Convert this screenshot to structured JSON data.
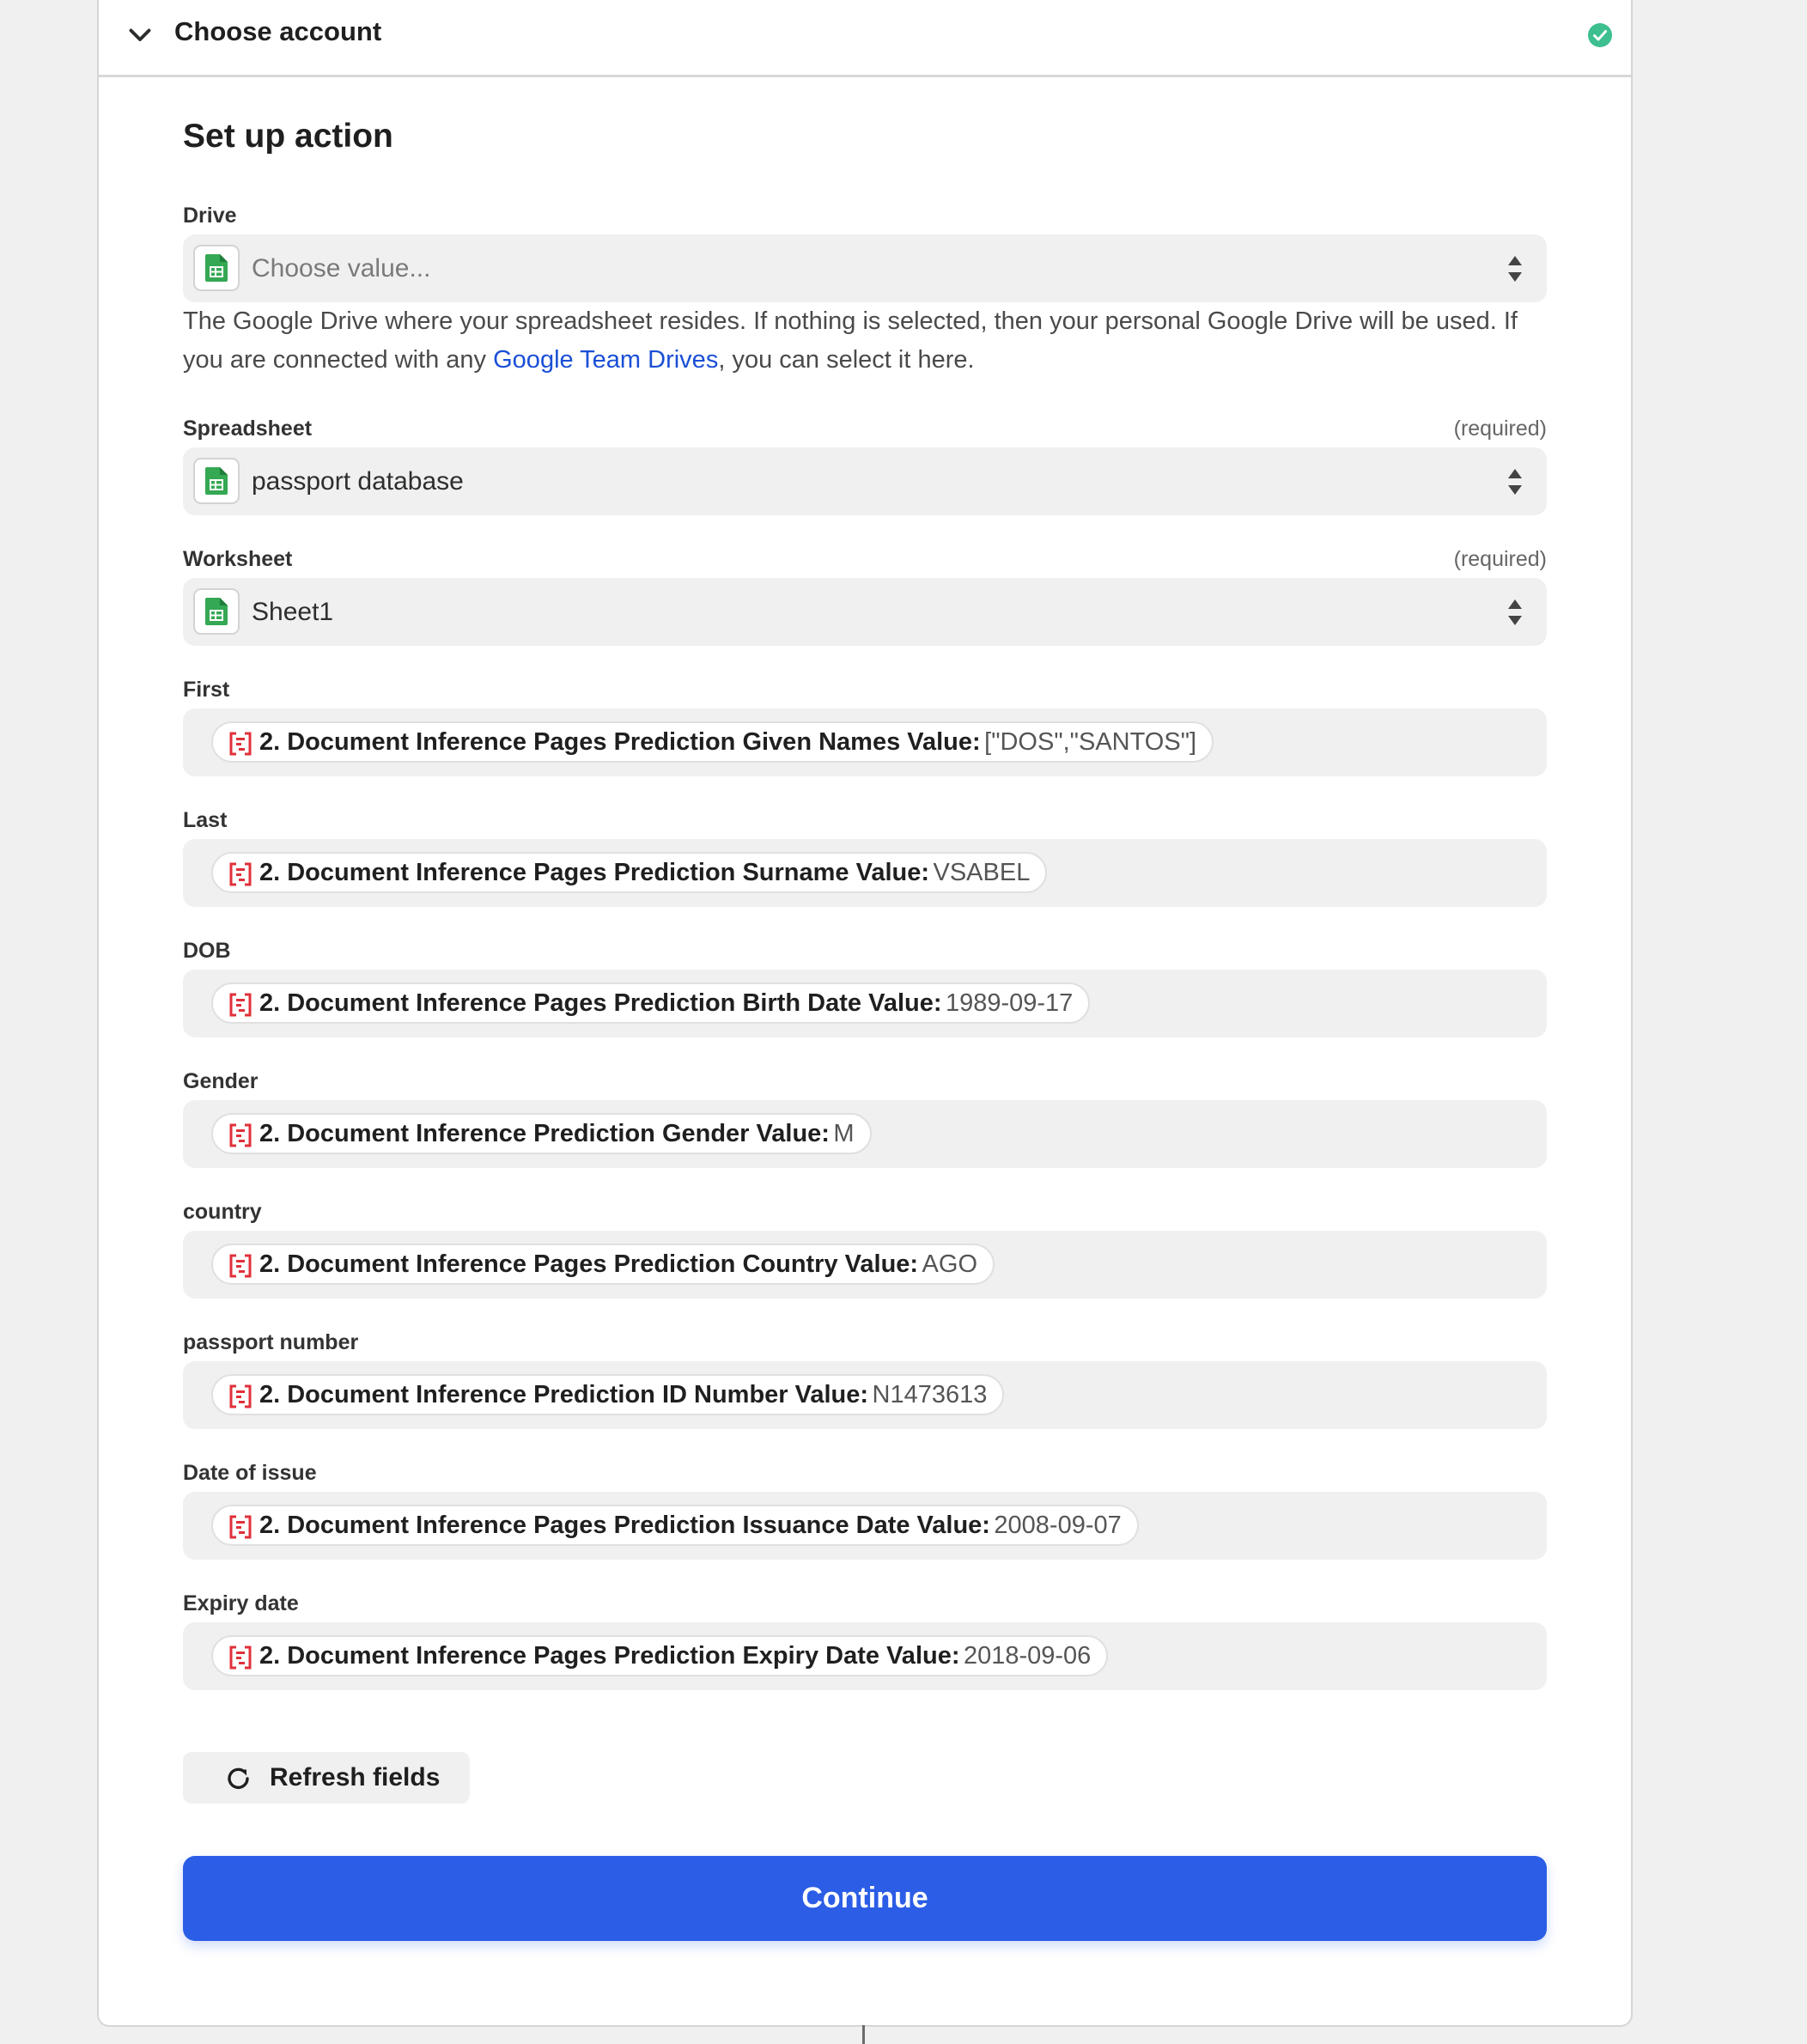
{
  "header": {
    "title": "Choose account"
  },
  "section": {
    "title": "Set up action"
  },
  "drive": {
    "label": "Drive",
    "placeholder": "Choose value...",
    "help_before": "The Google Drive where your spreadsheet resides. If nothing is selected, then your personal Google Drive will be used. If you are connected with any ",
    "help_link": "Google Team Drives",
    "help_after": ", you can select it here."
  },
  "spreadsheet": {
    "label": "Spreadsheet",
    "required": "(required)",
    "value": "passport database"
  },
  "worksheet": {
    "label": "Worksheet",
    "required": "(required)",
    "value": "Sheet1"
  },
  "mapped_fields": [
    {
      "label": "First",
      "pill_label": "2. Document Inference Pages Prediction Given Names Value:",
      "pill_value": "[\"DOS\",\"SANTOS\"]"
    },
    {
      "label": "Last",
      "pill_label": "2. Document Inference Pages Prediction Surname Value:",
      "pill_value": "VSABEL"
    },
    {
      "label": "DOB",
      "pill_label": "2. Document Inference Pages Prediction Birth Date Value:",
      "pill_value": "1989-09-17"
    },
    {
      "label": "Gender",
      "pill_label": "2. Document Inference Prediction Gender Value:",
      "pill_value": "M"
    },
    {
      "label": "country",
      "pill_label": "2. Document Inference Pages Prediction Country Value:",
      "pill_value": "AGO"
    },
    {
      "label": "passport number",
      "pill_label": "2. Document Inference Prediction ID Number Value:",
      "pill_value": "N1473613"
    },
    {
      "label": "Date of issue",
      "pill_label": "2. Document Inference Pages Prediction Issuance Date Value:",
      "pill_value": "2008-09-07"
    },
    {
      "label": "Expiry date",
      "pill_label": "2. Document Inference Pages Prediction Expiry Date Value:",
      "pill_value": "2018-09-06"
    }
  ],
  "buttons": {
    "refresh": "Refresh fields",
    "continue": "Continue"
  },
  "colors": {
    "accent": "#2b5de6",
    "success": "#3dbf8f",
    "sheets_green": "#34a853",
    "mapped_icon": "#e0303a"
  }
}
